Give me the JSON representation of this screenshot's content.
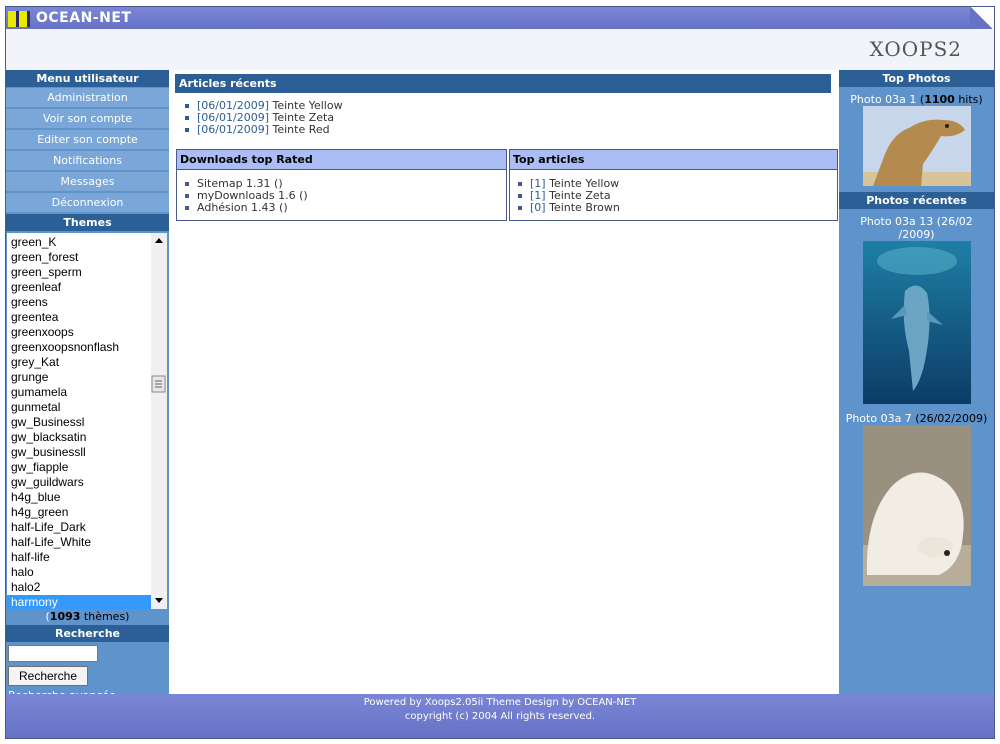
{
  "site": {
    "name": "OCEAN-NET",
    "logo_text": "XOOPS2"
  },
  "left": {
    "user_menu_title": "Menu utilisateur",
    "menu_items": [
      "Administration",
      "Voir son compte",
      "Editer son compte",
      "Notifications",
      "Messages",
      "Déconnexion"
    ],
    "themes_title": "Themes",
    "themes": [
      "green_K",
      "green_forest",
      "green_sperm",
      "greenleaf",
      "greens",
      "greentea",
      "greenxoops",
      "greenxoopsnonflash",
      "grey_Kat",
      "grunge",
      "gumamela",
      "gunmetal",
      "gw_Businessl",
      "gw_blacksatin",
      "gw_businessll",
      "gw_fiapple",
      "gw_guildwars",
      "h4g_blue",
      "h4g_green",
      "half-Life_Dark",
      "half-Life_White",
      "half-life",
      "halo",
      "halo2",
      "harmony"
    ],
    "selected_theme": "harmony",
    "theme_count_prefix": "(",
    "theme_count": "1093",
    "theme_count_suffix": " thèmes)",
    "search_title": "Recherche",
    "search_value": "",
    "search_button": "Recherche",
    "advanced_search": "Recherche avancée"
  },
  "center": {
    "recent_title": "Articles récents",
    "recent_articles": [
      {
        "date": "[06/01/2009]",
        "title": "Teinte Yellow"
      },
      {
        "date": "[06/01/2009]",
        "title": "Teinte Zeta"
      },
      {
        "date": "[06/01/2009]",
        "title": "Teinte Red"
      }
    ],
    "downloads_title": "Downloads top Rated",
    "downloads": [
      "Sitemap 1.31 ()",
      "myDownloads 1.6 ()",
      "Adhésion 1.43 ()"
    ],
    "top_title": "Top articles",
    "top_articles": [
      {
        "count": "[1]",
        "title": "Teinte Yellow"
      },
      {
        "count": "[1]",
        "title": "Teinte Zeta"
      },
      {
        "count": "[0]",
        "title": "Teinte Brown"
      }
    ]
  },
  "right": {
    "top_photos_title": "Top Photos",
    "top_photo_caption_link": "Photo 03a 1",
    "top_photo_hits_pre": " (",
    "top_photo_hits": "1100",
    "top_photo_hits_post": " hits)",
    "recent_photos_title": "Photos récentes",
    "recent_photo1_link": "Photo 03a 13",
    "recent_photo1_date_a": " (26/02",
    "recent_photo1_date_b": "/2009)",
    "recent_photo2_link": "Photo 03a 7",
    "recent_photo2_date": " (26/02/2009)"
  },
  "footer": {
    "line1": "Powered by Xoops2.05ii Theme Design by OCEAN-NET",
    "line2": "copyright (c) 2004 All rights reserved."
  },
  "colors": {
    "accent": "#2c5f96",
    "sidebar": "#5f93cc",
    "menu_item": "#7aa6d8",
    "box_header": "#aabdf5",
    "topbar": "#6672c4",
    "selection": "#3399ff"
  }
}
